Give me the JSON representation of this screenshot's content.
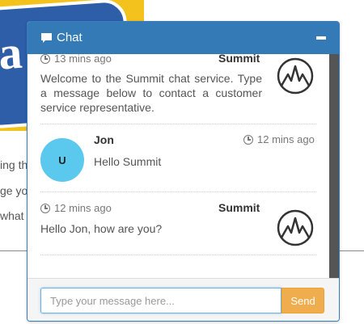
{
  "background": {
    "logo_text": "Sa",
    "lines": [
      "ing th",
      "ge you",
      "what"
    ]
  },
  "chat": {
    "title": "Chat",
    "messages": [
      {
        "sender": "Summit",
        "time": "13 mins ago",
        "text": "Welcome to the Summit chat service. Type a message below to contact a customer service representative.",
        "avatar": "summit-logo"
      },
      {
        "sender": "Jon",
        "time": "12 mins ago",
        "text": "Hello Summit",
        "avatar_initial": "U"
      },
      {
        "sender": "Summit",
        "time": "12 mins ago",
        "text": "Hello Jon, how are you?",
        "avatar": "summit-logo"
      }
    ],
    "input": {
      "placeholder": "Type your message here...",
      "value": ""
    },
    "send_label": "Send"
  },
  "colors": {
    "header": "#337ab7",
    "send_button": "#f0ad4e",
    "user_avatar": "#5bc8ee"
  }
}
